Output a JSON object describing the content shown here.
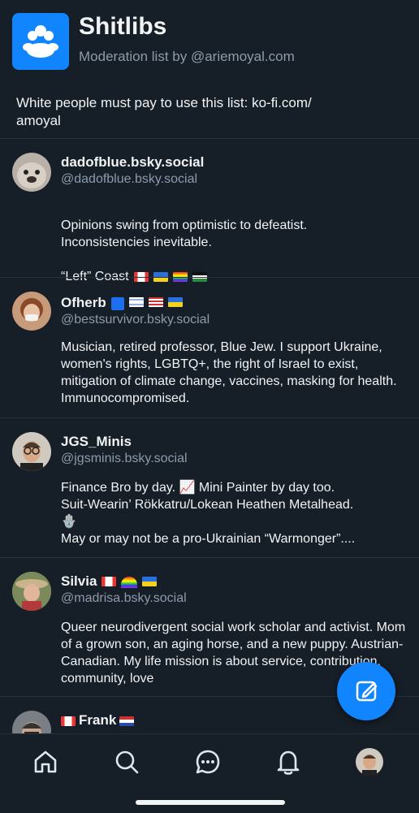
{
  "list": {
    "title": "Shitlibs",
    "subtitle": "Moderation list by @ariemoyal.com",
    "description": "White people must pay to use this list: ko-fi.com/\namoyal"
  },
  "members": [
    {
      "name": "dadofblue.bsky.social",
      "handle": "@dadofblue.bsky.social",
      "bio": "Opinions swing from optimistic to defeatist.\nInconsistencies inevitable.\n\n“Left” Coast",
      "avatar_color": "#b9b1a8"
    },
    {
      "name": "Ofherb",
      "handle": "@bestsurvivor.bsky.social",
      "bio": "Musician, retired professor, Blue Jew. I support Ukraine, women's rights, LGBTQ+, the right of Israel to exist, mitigation of climate change, vaccines, masking for health. Immunocompromised.",
      "avatar_color": "#c79a7a"
    },
    {
      "name": "JGS_Minis",
      "handle": "@jgsminis.bsky.social",
      "bio": "Finance Bro by day. 📈 Mini Painter by day too.\nSuit-Wearin’ Rökkatru/Lokean Heathen Metalhead.\n🪬\nMay or may not be a pro-Ukrainian “Warmonger”....",
      "avatar_color": "#8a7a6a"
    },
    {
      "name": "Silvia",
      "handle": "@madrisa.bsky.social",
      "bio": "Queer neurodivergent social work scholar and activist. Mom of a grown son, an aging horse, and a new puppy. Austrian-Canadian. My life mission is about service, contribution, community, love",
      "avatar_color": "#9a8a6a"
    },
    {
      "name": "Frank",
      "handle": "",
      "bio": "",
      "avatar_color": "#7a7f86"
    }
  ],
  "colors": {
    "background": "#161e27",
    "accent": "#1185fe",
    "muted_text": "#8d9bab",
    "divider": "#26313d"
  },
  "tabs": [
    "home-icon",
    "search-icon",
    "messages-icon",
    "notifications-icon",
    "profile-avatar"
  ],
  "fab_icon": "compose-icon"
}
